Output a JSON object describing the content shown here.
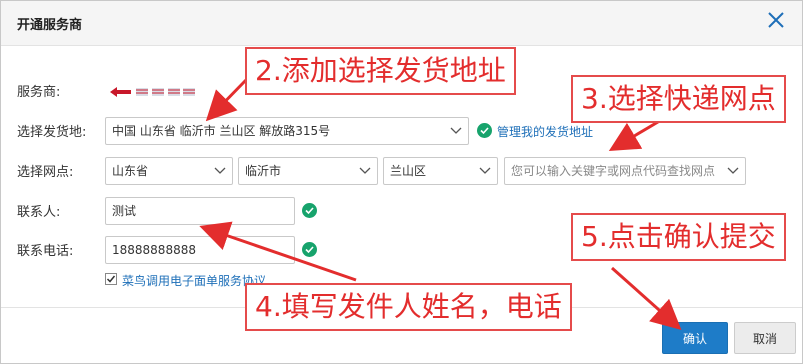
{
  "dialog": {
    "title": "开通服务商",
    "close_icon": "close-icon"
  },
  "form": {
    "provider_label": "服务商:",
    "provider_logo_text": "品骏快递",
    "address_label": "选择发货地:",
    "address_value": "中国 山东省 临沂市 兰山区 解放路315号",
    "manage_address_link": "管理我的发货地址",
    "outlet_label": "选择网点:",
    "province": "山东省",
    "city": "临沂市",
    "district": "兰山区",
    "outlet_placeholder": "您可以输入关键字或网点代码查找网点",
    "contact_label": "联系人:",
    "contact_value": "测试",
    "phone_label": "联系电话:",
    "phone_value": "18888888888",
    "agreement_checked": true,
    "agreement_text": "菜鸟调用电子面单服务协议"
  },
  "buttons": {
    "confirm": "确认",
    "cancel": "取消"
  },
  "annotations": {
    "step2": "2.添加选择发货地址",
    "step3": "3.选择快递网点",
    "step4": "4.填写发件人姓名，电话",
    "step5": "5.点击确认提交"
  },
  "colors": {
    "accent": "#1e7cc8",
    "success": "#17a36c",
    "annotation": "#e32d2d"
  }
}
